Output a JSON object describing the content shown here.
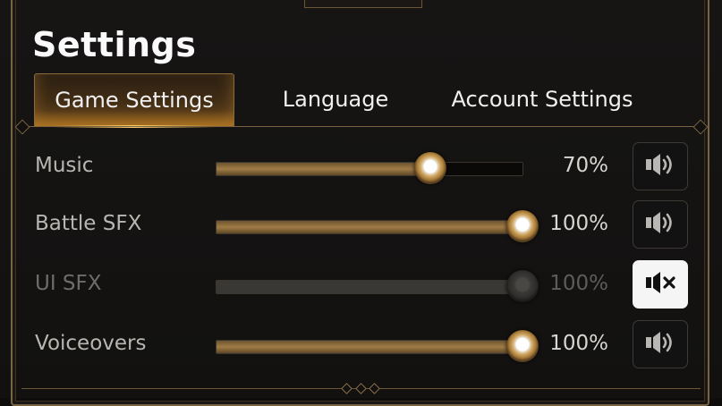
{
  "title": "Settings",
  "tabs": [
    {
      "label": "Game Settings",
      "active": true
    },
    {
      "label": "Language",
      "active": false
    },
    {
      "label": "Account Settings",
      "active": false
    }
  ],
  "settings": [
    {
      "label": "Music",
      "value_text": "70%",
      "value": 0.7,
      "muted": false,
      "sound_icon": "speaker-icon"
    },
    {
      "label": "Battle SFX",
      "value_text": "100%",
      "value": 1.0,
      "muted": false,
      "sound_icon": "speaker-icon"
    },
    {
      "label": "UI SFX",
      "value_text": "100%",
      "value": 1.0,
      "muted": true,
      "sound_icon": "speaker-muted-icon"
    },
    {
      "label": "Voiceovers",
      "value_text": "100%",
      "value": 1.0,
      "muted": false,
      "sound_icon": "speaker-icon"
    }
  ],
  "colors": {
    "accent": "#c9a25a",
    "background": "#121110",
    "muted_button": "#f5f5f5"
  }
}
